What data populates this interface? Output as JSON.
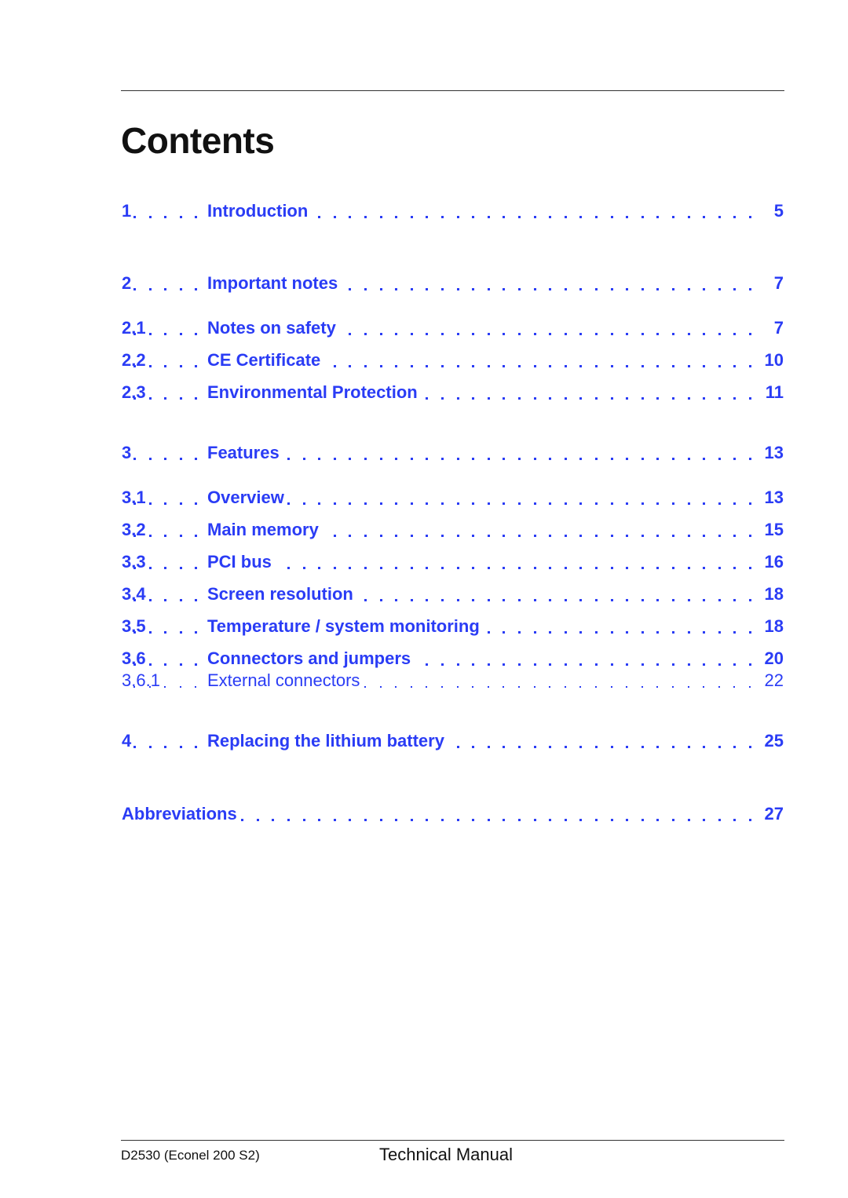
{
  "page": {
    "title": "Contents",
    "accent_color": "#2a3cf5"
  },
  "toc": [
    {
      "number": "1",
      "label": "Introduction",
      "page": "5",
      "level": 1
    },
    {
      "number": "2",
      "label": "Important notes",
      "page": "7",
      "level": 1
    },
    {
      "number": "2.1",
      "label": "Notes on safety",
      "page": "7",
      "level": 2
    },
    {
      "number": "2.2",
      "label": "CE Certificate",
      "page": "10",
      "level": 2
    },
    {
      "number": "2.3",
      "label": "Environmental Protection",
      "page": "11",
      "level": 2
    },
    {
      "number": "3",
      "label": "Features",
      "page": "13",
      "level": 1
    },
    {
      "number": "3.1",
      "label": "Overview",
      "page": "13",
      "level": 2
    },
    {
      "number": "3.2",
      "label": "Main memory",
      "page": "15",
      "level": 2
    },
    {
      "number": "3.3",
      "label": "PCI bus",
      "page": "16",
      "level": 2
    },
    {
      "number": "3.4",
      "label": "Screen resolution",
      "page": "18",
      "level": 2
    },
    {
      "number": "3.5",
      "label": "Temperature / system monitoring",
      "page": "18",
      "level": 2
    },
    {
      "number": "3.6",
      "label": "Connectors and jumpers",
      "page": "20",
      "level": 2
    },
    {
      "number": "3.6.1",
      "label": "External connectors",
      "page": "22",
      "level": 3
    },
    {
      "number": "4",
      "label": "Replacing the lithium battery",
      "page": "25",
      "level": 1
    },
    {
      "number": "",
      "label": "Abbreviations",
      "page": "27",
      "level": 1
    }
  ],
  "footer": {
    "product": "D2530 (Econel 200 S2)",
    "doc_type": "Technical Manual"
  }
}
